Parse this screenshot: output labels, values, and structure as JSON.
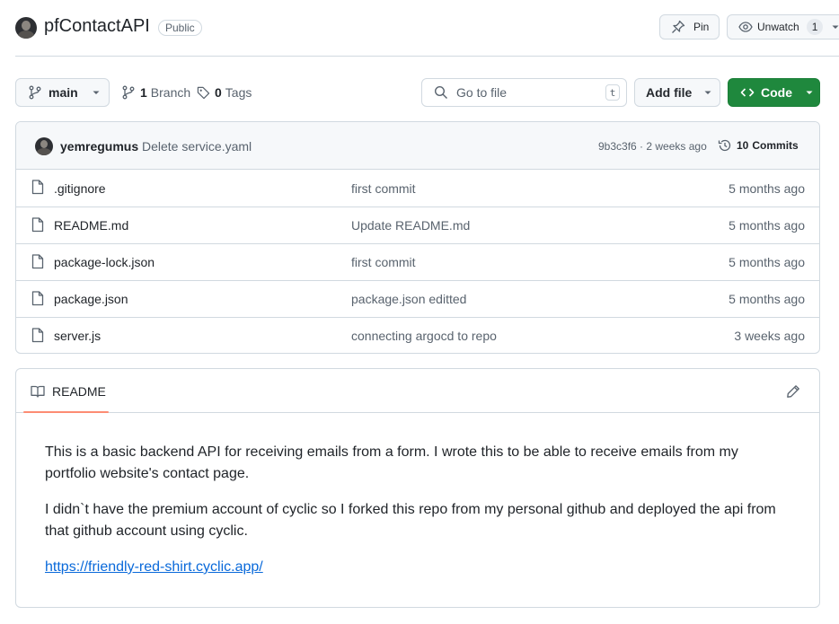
{
  "repo": {
    "name": "pfContactAPI",
    "visibility": "Public"
  },
  "actions": {
    "pin_label": "Pin",
    "unwatch_label": "Unwatch",
    "watch_count": "1"
  },
  "toolbar": {
    "branch": "main",
    "branch_count": "1",
    "branch_label": "Branch",
    "tag_count": "0",
    "tag_label": "Tags",
    "search_placeholder": "Go to file",
    "search_shortcut": "t",
    "add_file_label": "Add file",
    "code_label": "Code"
  },
  "latest_commit": {
    "author": "yemregumus",
    "message": "Delete service.yaml",
    "hash_and_time": "9b3c3f6 · 2 weeks ago",
    "commits_count": "10",
    "commits_label": "Commits"
  },
  "files": [
    {
      "name": ".gitignore",
      "message": "first commit",
      "time": "5 months ago"
    },
    {
      "name": "README.md",
      "message": "Update README.md",
      "time": "5 months ago"
    },
    {
      "name": "package-lock.json",
      "message": "first commit",
      "time": "5 months ago"
    },
    {
      "name": "package.json",
      "message": "package.json editted",
      "time": "5 months ago"
    },
    {
      "name": "server.js",
      "message": "connecting argocd to repo",
      "time": "3 weeks ago"
    }
  ],
  "readme": {
    "tab_label": "README",
    "paragraph1": "This is a basic backend API for receiving emails from a form. I wrote this to be able to receive emails from my portfolio website's contact page.",
    "paragraph2": "I didn`t have the premium account of cyclic so I forked this repo from my personal github and deployed the api from that github account using cyclic.",
    "link": "https://friendly-red-shirt.cyclic.app/"
  },
  "colors": {
    "accent_green": "#1f883d",
    "link_blue": "#0969da",
    "tab_underline": "#fd8c73"
  }
}
